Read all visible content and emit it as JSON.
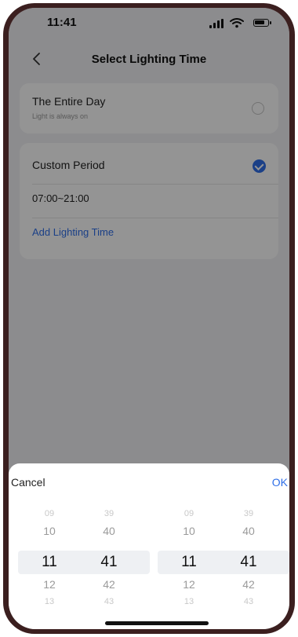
{
  "status_bar": {
    "time": "11:41"
  },
  "nav": {
    "title": "Select Lighting Time",
    "back_icon": "chevron-left-icon"
  },
  "options": {
    "entire_day": {
      "title": "The Entire Day",
      "subtitle": "Light is always on",
      "selected": false
    },
    "custom_period": {
      "title": "Custom Period",
      "selected": true,
      "time_range": "07:00~21:00",
      "add_label": "Add Lighting Time"
    }
  },
  "picker_sheet": {
    "cancel_label": "Cancel",
    "ok_label": "OK",
    "start": {
      "hours": [
        "09",
        "10",
        "11",
        "12",
        "13"
      ],
      "minutes": [
        "39",
        "40",
        "41",
        "42",
        "43"
      ],
      "selected_hour": "11",
      "selected_minute": "41"
    },
    "end": {
      "hours": [
        "09",
        "10",
        "11",
        "12",
        "13"
      ],
      "minutes": [
        "39",
        "40",
        "41",
        "42",
        "43"
      ],
      "selected_hour": "11",
      "selected_minute": "41"
    }
  },
  "colors": {
    "accent": "#2f6fe8",
    "background": "#f1f2f4",
    "overlay": "rgba(0,0,0,0.42)"
  }
}
